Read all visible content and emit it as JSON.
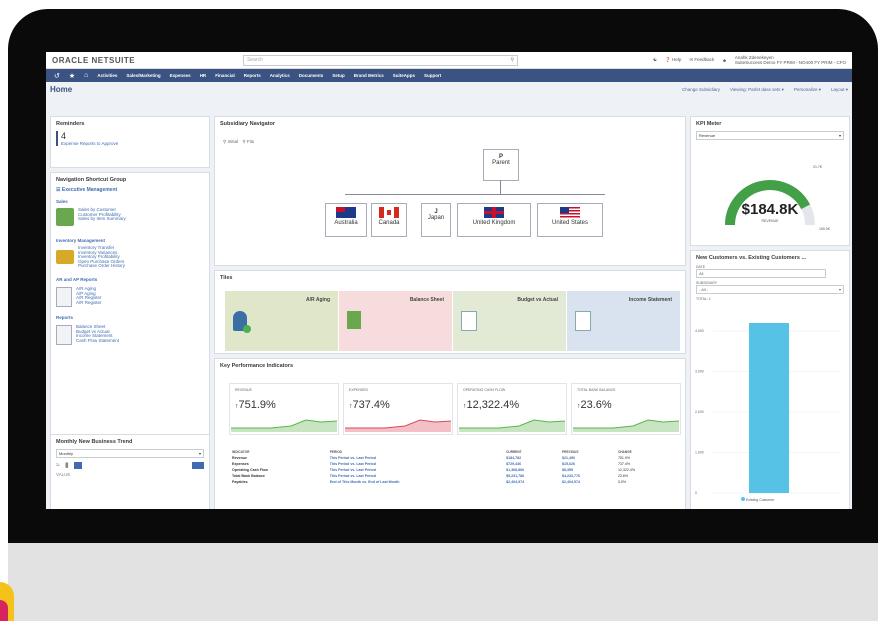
{
  "brand": {
    "logo": "ORACLE NETSUITE"
  },
  "search": {
    "placeholder": "Search"
  },
  "top_right": {
    "help": "Help",
    "feedback": "Feedback",
    "user_line1": "Anahk Zdenekeyen",
    "user_line2": "SuiteSuccess Demo FY PRIM - NO400 FY PRIM - CFO"
  },
  "nav": {
    "items": [
      "Activities",
      "Sales/Marketing",
      "Expenses",
      "HR",
      "Financial",
      "Reports",
      "Analytics",
      "Documents",
      "Setup",
      "Brand Metrics",
      "SuiteApps",
      "Support"
    ]
  },
  "home": {
    "title": "Home",
    "change_subsidiary": "Change Subsidiary",
    "viewing": "Viewing: Parfet dass sets ▾",
    "personalize": "Personalize ▾",
    "layout": "Layout ▾"
  },
  "reminders": {
    "title": "Reminders",
    "count": "4",
    "label": "Expense Reports to Approve"
  },
  "shortcut": {
    "title": "Navigation Shortcut Group",
    "group": "Executive Management",
    "sections": [
      {
        "title": "Sales",
        "links": [
          "Sales by Customer",
          "Customer Profitability",
          "Sales by Item Summary"
        ]
      },
      {
        "title": "Inventory Management",
        "links": [
          "Inventory Transfer",
          "Inventory Variances",
          "Inventory Profitability",
          "Open Purchase Orders",
          "Purchase Order History"
        ]
      },
      {
        "title": "AR and AP Reports",
        "links": [
          "A/R Aging",
          "A/P Aging",
          "A/R Register",
          "A/R Register"
        ]
      },
      {
        "title": "Reports",
        "links": [
          "Balance Sheet",
          "Budget vs Actual",
          "Income Statement",
          "Cash Flow Statement"
        ]
      }
    ]
  },
  "trend": {
    "title": "Monthly New Business Trend",
    "select": "Monthly",
    "footer": "VALUE"
  },
  "subsidiary": {
    "title": "Subsidiary Navigator",
    "controls": [
      "Initial",
      "Fits"
    ],
    "parent_letter": "P",
    "parent_label": "Parent",
    "children": [
      {
        "label": "Australia",
        "flag": "au"
      },
      {
        "label": "Canada",
        "flag": "ca"
      },
      {
        "label": "Japan",
        "flag": "jp",
        "letter": "J"
      },
      {
        "label": "United Kingdom",
        "flag": "uk"
      },
      {
        "label": "United States",
        "flag": "us"
      }
    ]
  },
  "tiles": {
    "title": "Tiles",
    "items": [
      {
        "label": "A/R Aging",
        "bg": "#dfe6c9"
      },
      {
        "label": "Balance Sheet",
        "bg": "#f6dcdd"
      },
      {
        "label": "Budget vs Actual",
        "bg": "#e2ead6"
      },
      {
        "label": "Income Statement",
        "bg": "#d9e3ef"
      }
    ]
  },
  "kpi": {
    "title": "Key Performance Indicators",
    "cards": [
      {
        "label": "REVENUE",
        "value": "751.9%",
        "color": "#5bb54a"
      },
      {
        "label": "EXPENSES",
        "value": "737.4%",
        "color": "#d94a5b"
      },
      {
        "label": "OPERATING CASH FLOW",
        "value": "12,322.4%",
        "color": "#5bb54a"
      },
      {
        "label": "TOTAL BANK BALANCE",
        "value": "23.6%",
        "color": "#5bb54a"
      }
    ],
    "columns": [
      "INDICATOR",
      "PERIOD",
      "CURRENT",
      "PREVIOUS",
      "CHANGE"
    ],
    "rows": [
      [
        "Revenue",
        "This Period vs. Last Period",
        "$184,782",
        "$21,490",
        "751.9%"
      ],
      [
        "Expenses",
        "This Period vs. Last Period",
        "$729,436",
        "$15,626",
        "737.4%"
      ],
      [
        "Operating Cash Flow",
        "This Period vs. Last Period",
        "$1,368,866",
        "$8,355",
        "12,322.4%"
      ],
      [
        "Total Bank Balance",
        "This Period vs. Last Period",
        "$5,231,786",
        "$4,233,776",
        "23.6%"
      ],
      [
        "Payables",
        "End of This Month vs. End of Last Month",
        "$2,404,974",
        "$2,404,974",
        "0.0%"
      ]
    ]
  },
  "kpi_meter": {
    "title": "KPI Meter",
    "select": "Revenue",
    "value": "$184.8K",
    "caption": "REVENUE",
    "max_tick": "21.7K",
    "right_tick": "150.0K",
    "fill_fraction": 0.85
  },
  "customers": {
    "title": "New Customers vs. Existing Customers ...",
    "date_label": "DATE",
    "date_value": "All",
    "subsidiary_label": "SUBSIDIARY",
    "subsidiary_value": "- All -",
    "total_label": "TOTAL: 1",
    "legend": "Existing Customer",
    "chart_data": {
      "type": "bar",
      "categories": [
        "Existing Customer"
      ],
      "values": [
        4200
      ],
      "ylim": [
        0,
        4000
      ],
      "yticks": [
        "4,000",
        "3,000",
        "2,000",
        "1,000",
        "0"
      ]
    }
  }
}
